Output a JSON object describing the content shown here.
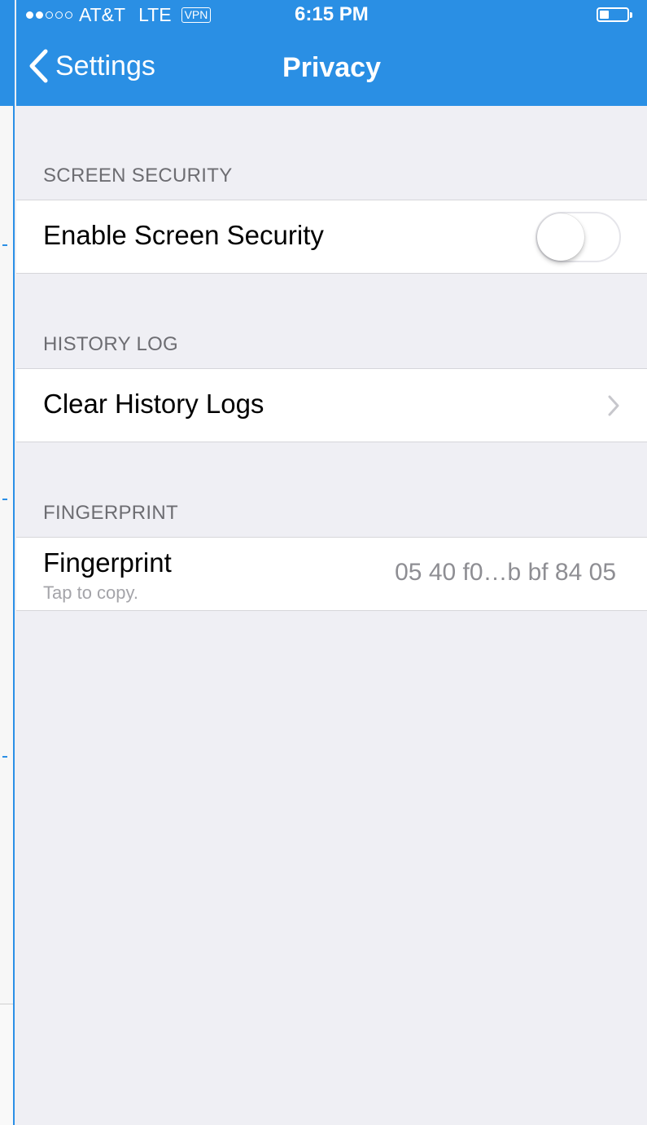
{
  "status_bar": {
    "signal_dots": [
      true,
      true,
      false,
      false,
      false
    ],
    "carrier": "AT&T",
    "network": "LTE",
    "vpn": "VPN",
    "time": "6:15 PM",
    "battery_level": 0.35
  },
  "nav": {
    "back_label": "Settings",
    "title": "Privacy"
  },
  "sections": {
    "screen_security": {
      "header": "SCREEN SECURITY",
      "row_label": "Enable Screen Security",
      "toggle_on": false
    },
    "history_log": {
      "header": "HISTORY LOG",
      "row_label": "Clear History Logs"
    },
    "fingerprint": {
      "header": "FINGERPRINT",
      "row_label": "Fingerprint",
      "row_sublabel": "Tap to copy.",
      "value": "05 40 f0…b bf 84 05"
    }
  },
  "colors": {
    "accent": "#2a8fe4",
    "background": "#efeff4",
    "secondary_text": "#6d6d72",
    "detail_text": "#8e8e93"
  },
  "icons": {
    "back": "chevron-left-icon",
    "disclosure": "chevron-right-icon",
    "battery": "battery-icon"
  }
}
